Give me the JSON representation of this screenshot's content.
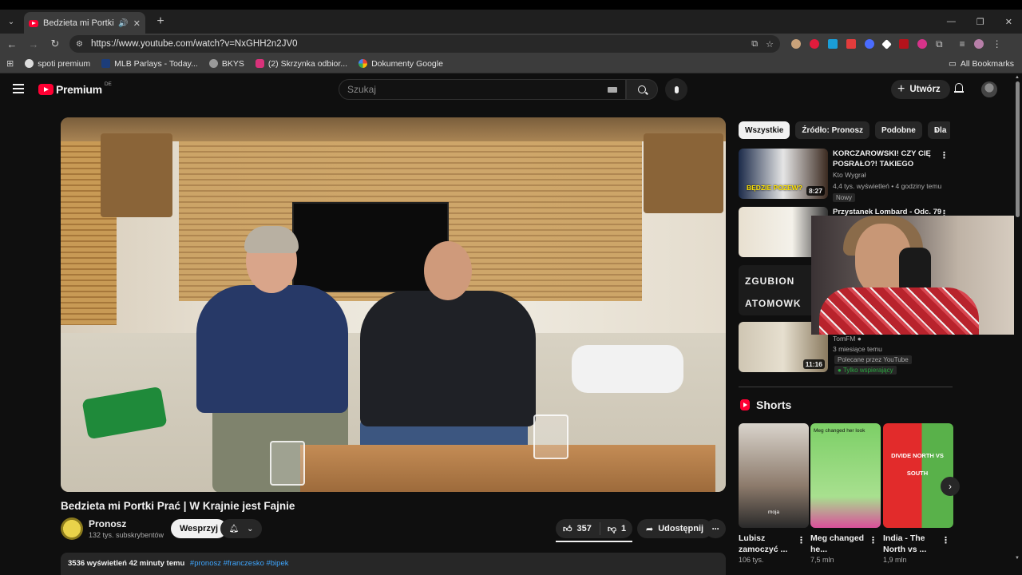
{
  "browser": {
    "tab_title": "Bedzieta mi Portki Prać | W",
    "url": "https://www.youtube.com/watch?v=NxGHH2n2JV0",
    "bookmarks": [
      "spoti premium",
      "MLB Parlays - Today...",
      "BKYS",
      "(2) Skrzynka odbior...",
      "Dokumenty Google"
    ],
    "all_bookmarks": "All Bookmarks"
  },
  "masthead": {
    "logo_text": "Premium",
    "country_code": "DE",
    "search_placeholder": "Szukaj",
    "create_label": "Utwórz"
  },
  "video": {
    "title": "Bedzieta mi Portki Prać | W Krajnie jest Fajnie",
    "channel_name": "Pronosz",
    "subscribers": "132 tys. subskrybentów",
    "support_label": "Wesprzyj",
    "likes": "357",
    "dislikes": "1",
    "share_label": "Udostępnij",
    "description_stats": "3536 wyświetleń  42 minuty temu",
    "description_tags": "#pronosz #franczesko #bipek"
  },
  "chips": [
    "Wszystkie",
    "Źródło: Pronosz",
    "Podobne",
    "Dla"
  ],
  "recommendations": [
    {
      "title": "KORCZAROWSKI! CZY CIĘ POSRAŁO?! TAKIEGO GÓWNA ...",
      "channel": "Kto Wygrał",
      "meta": "4,4 tys. wyświetleń • 4 godziny temu",
      "badge": "Nowy",
      "duration": "8:27",
      "thumb_text": "BĘDZIE POZEW?"
    },
    {
      "title": "Przystanek Lombard - Odc. 79",
      "channel": "",
      "meta": "",
      "badge": "",
      "duration": "5",
      "thumb_text": ""
    },
    {
      "title": "",
      "channel": "",
      "meta": "",
      "badge": "",
      "duration": "",
      "thumb_text": "ZGUBION ATOMOWK"
    },
    {
      "title": "",
      "channel": "TomFM",
      "meta": "3 miesiące temu",
      "badge": "Polecane przez YouTube",
      "badge2": "Tylko wspierający",
      "duration": "11:16",
      "thumb_text": ""
    }
  ],
  "shorts": {
    "heading": "Shorts",
    "items": [
      {
        "title": "Lubisz zamoczyć ...",
        "views": "106 tys.",
        "caption": "moja"
      },
      {
        "title": "Meg changed he...",
        "views": "7,5 mln",
        "caption": "Meg changed her look"
      },
      {
        "title": "India - The North vs ...",
        "views": "1,9 mln",
        "caption": "DIVIDE NORTH VS SOUTH"
      }
    ]
  },
  "colors": {
    "background": "#0f0f0f",
    "youtube_red": "#ff0033",
    "chip_active": "#f1f1f1",
    "link_blue": "#3ea6ff",
    "supporter_green": "#2ba640"
  }
}
